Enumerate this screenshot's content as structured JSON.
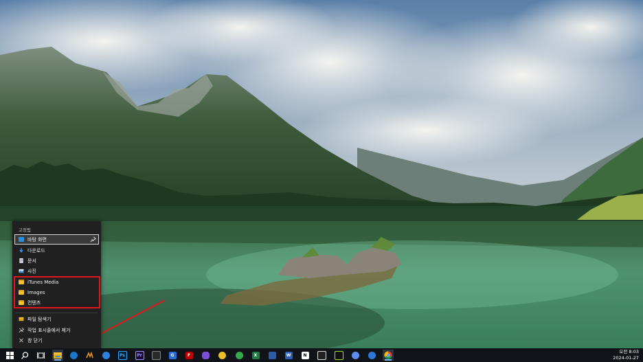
{
  "jumplist": {
    "header": "고정됨",
    "pinned": [
      {
        "label": "바탕 화면",
        "icon": "desktop-folder-icon"
      },
      {
        "label": "다운로드",
        "icon": "download-arrow-icon"
      },
      {
        "label": "문서",
        "icon": "document-icon"
      },
      {
        "label": "사진",
        "icon": "pictures-icon"
      },
      {
        "label": "iTunes Media",
        "icon": "folder-icon"
      },
      {
        "label": "Images",
        "icon": "folder-icon"
      },
      {
        "label": "컨텐츠",
        "icon": "folder-icon"
      }
    ],
    "actions": [
      {
        "label": "파일 탐색기",
        "icon": "file-explorer-icon"
      },
      {
        "label": "작업 표시줄에서 제거",
        "icon": "unpin-icon"
      },
      {
        "label": "창 닫기",
        "icon": "close-icon"
      }
    ]
  },
  "taskbar": {
    "apps": [
      "Ps",
      "Pr",
      "G",
      "F",
      "N",
      "W",
      "X"
    ],
    "time": "오전 8:03",
    "date": "2024-01-27"
  },
  "colors": {
    "highlight": "#e2161c",
    "taskbar": "#101418",
    "folder": "#f2c233"
  }
}
